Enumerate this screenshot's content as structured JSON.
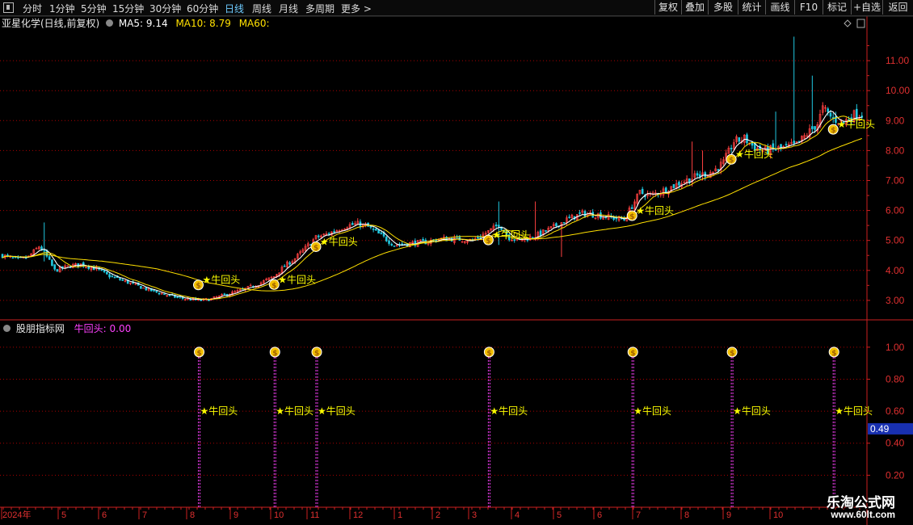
{
  "toolbar": {
    "periods": [
      "分时",
      "1分钟",
      "5分钟",
      "15分钟",
      "30分钟",
      "60分钟",
      "日线",
      "周线",
      "月线",
      "多周期",
      "更多 >"
    ],
    "active": "日线",
    "buttons": [
      "复权",
      "叠加",
      "多股",
      "统计",
      "画线",
      "F10",
      "标记",
      "+自选",
      "返回"
    ]
  },
  "main": {
    "stock_label": "亚星化学(日线,前复权)",
    "ma5": "MA5: 9.14",
    "ma10": "MA10: 8.79",
    "ma60": "MA60:"
  },
  "sub": {
    "indicator_label": "股朋指标网",
    "signal_label": "牛回头: 0.00",
    "current_value": "0.49"
  },
  "signal_text": "牛回头",
  "colors": {
    "up": "#ff4040",
    "down": "#20c8e0",
    "ma5": "#ffffff",
    "ma10": "#ffe000",
    "ma60": "#ffe000",
    "signal": "#ffff00",
    "grid": "#aa0000",
    "axis": "#cc2020"
  },
  "chart_data": [
    {
      "type": "candlestick",
      "title": "亚星化学(日线,前复权)",
      "y_ticks": [
        "3.00",
        "4.00",
        "5.00",
        "6.00",
        "7.00",
        "8.00",
        "9.00",
        "10.00",
        "11.00"
      ],
      "ylim": [
        2.35,
        12.0
      ],
      "x_ticks": [
        "2024年",
        "5",
        "6",
        "7",
        "8",
        "9",
        "10",
        "11",
        "12",
        "1",
        "2",
        "3",
        "4",
        "5",
        "6",
        "7",
        "8",
        "9",
        "10"
      ],
      "price_path": [
        [
          0,
          4.5
        ],
        [
          6,
          4.35
        ],
        [
          10,
          4.45
        ],
        [
          14,
          4.8
        ],
        [
          16,
          4.6
        ],
        [
          20,
          4.0
        ],
        [
          26,
          4.15
        ],
        [
          30,
          4.2
        ],
        [
          36,
          4.05
        ],
        [
          40,
          3.85
        ],
        [
          48,
          3.6
        ],
        [
          56,
          3.35
        ],
        [
          64,
          3.15
        ],
        [
          70,
          3.05
        ],
        [
          76,
          3.0
        ],
        [
          80,
          3.05
        ],
        [
          86,
          3.2
        ],
        [
          92,
          3.35
        ],
        [
          98,
          3.55
        ],
        [
          104,
          3.8
        ],
        [
          108,
          4.15
        ],
        [
          112,
          4.4
        ],
        [
          116,
          4.75
        ],
        [
          120,
          5.1
        ],
        [
          124,
          5.2
        ],
        [
          128,
          5.35
        ],
        [
          132,
          5.5
        ],
        [
          136,
          5.55
        ],
        [
          140,
          5.45
        ],
        [
          146,
          5.1
        ],
        [
          150,
          4.85
        ],
        [
          156,
          4.9
        ],
        [
          162,
          4.95
        ],
        [
          168,
          5.05
        ],
        [
          174,
          5.05
        ],
        [
          180,
          5.0
        ],
        [
          184,
          5.2
        ],
        [
          188,
          5.4
        ],
        [
          190,
          5.55
        ],
        [
          194,
          5.1
        ],
        [
          198,
          5.0
        ],
        [
          204,
          5.15
        ],
        [
          210,
          5.4
        ],
        [
          216,
          5.7
        ],
        [
          222,
          5.9
        ],
        [
          228,
          5.85
        ],
        [
          234,
          5.75
        ],
        [
          238,
          5.7
        ],
        [
          242,
          6.3
        ],
        [
          244,
          6.6
        ],
        [
          248,
          6.5
        ],
        [
          254,
          6.7
        ],
        [
          260,
          6.95
        ],
        [
          266,
          7.15
        ],
        [
          272,
          7.3
        ],
        [
          276,
          7.6
        ],
        [
          280,
          8.3
        ],
        [
          284,
          8.4
        ],
        [
          288,
          8.1
        ],
        [
          292,
          8.0
        ],
        [
          296,
          8.05
        ],
        [
          300,
          8.1
        ],
        [
          304,
          8.2
        ],
        [
          308,
          8.55
        ],
        [
          312,
          8.9
        ],
        [
          314,
          9.4
        ],
        [
          318,
          9.05
        ],
        [
          322,
          8.95
        ],
        [
          326,
          9.2
        ]
      ],
      "annotations": [
        "牛回头"
      ],
      "signal_points": [
        75,
        104,
        120,
        186,
        241,
        279,
        318
      ]
    },
    {
      "type": "spike",
      "title": "股朋指标网",
      "series": [
        {
          "name": "牛回头",
          "values": [
            1,
            1,
            1,
            1,
            1,
            1,
            1
          ]
        }
      ],
      "x_indices": [
        75,
        104,
        120,
        186,
        241,
        279,
        318
      ],
      "y_ticks": [
        "0.20",
        "0.40",
        "0.60",
        "0.80",
        "1.00"
      ],
      "ylim": [
        0.0,
        1.08
      ]
    }
  ]
}
